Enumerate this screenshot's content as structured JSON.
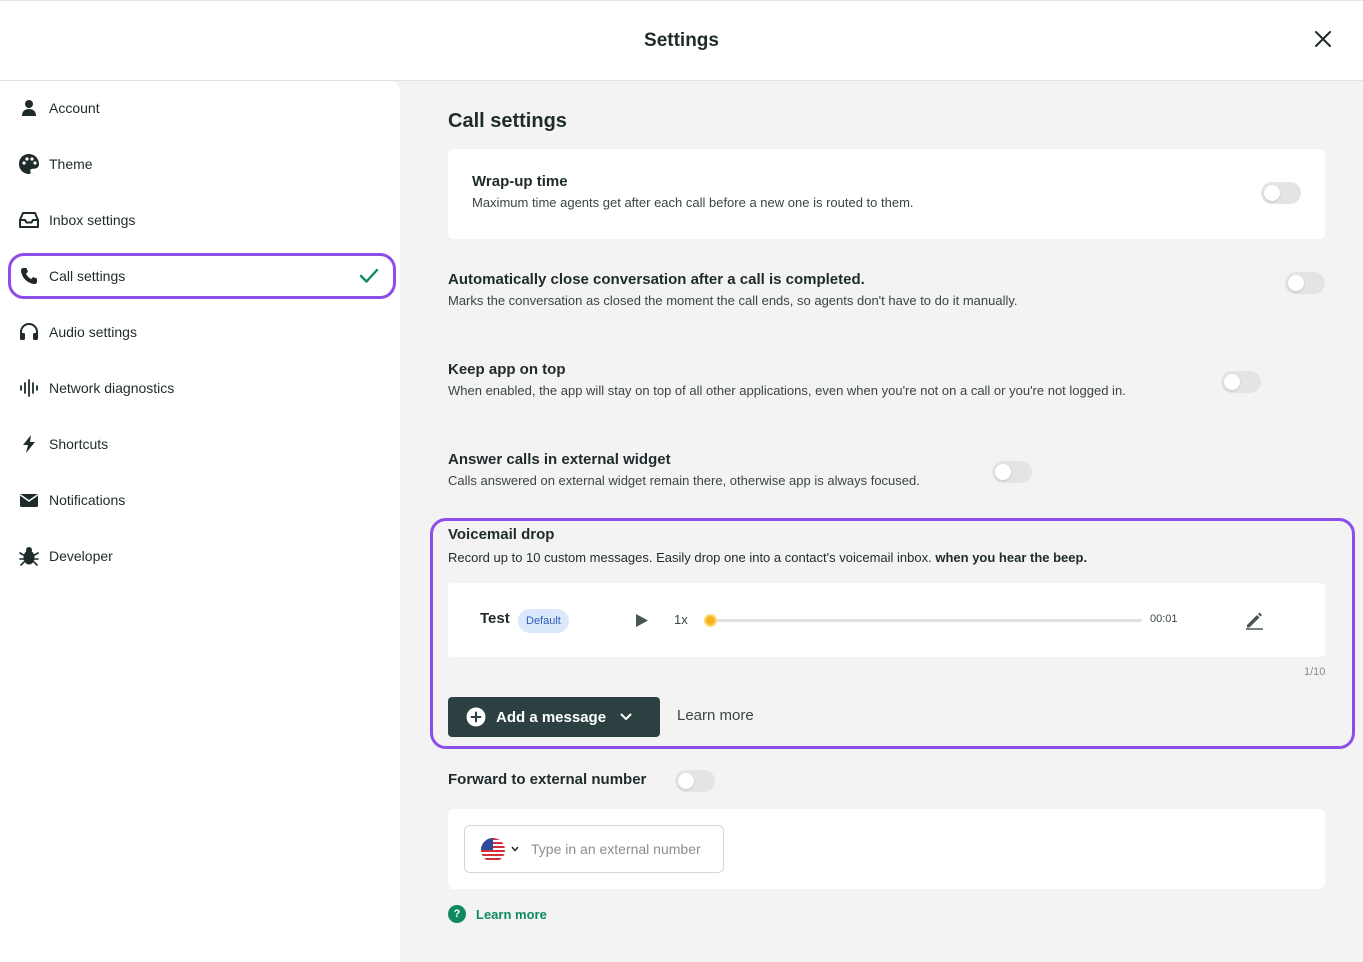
{
  "header": {
    "title": "Settings",
    "close_icon": "close-icon"
  },
  "sidebar": {
    "items": [
      {
        "label": "Account",
        "icon": "person-icon"
      },
      {
        "label": "Theme",
        "icon": "palette-icon"
      },
      {
        "label": "Inbox settings",
        "icon": "inbox-icon"
      },
      {
        "label": "Call settings",
        "icon": "phone-icon",
        "active": true
      },
      {
        "label": "Audio settings",
        "icon": "headset-icon"
      },
      {
        "label": "Network diagnostics",
        "icon": "waveform-icon"
      },
      {
        "label": "Shortcuts",
        "icon": "lightning-icon"
      },
      {
        "label": "Notifications",
        "icon": "envelope-icon"
      },
      {
        "label": "Developer",
        "icon": "bug-icon"
      }
    ]
  },
  "main": {
    "title": "Call settings",
    "settings": [
      {
        "title": "Wrap-up time",
        "desc": "Maximum time agents get after each call before a new one is routed to them.",
        "enabled": false
      },
      {
        "title": "Automatically close conversation after a call is completed.",
        "desc": "Marks the conversation as closed the moment the call ends, so agents don't have to do it manually.",
        "enabled": false
      },
      {
        "title": "Keep app on top",
        "desc": "When enabled, the app will stay on top of all other applications, even when you're not on a call or you're not logged in.",
        "enabled": false
      },
      {
        "title": "Answer calls in external widget",
        "desc": "Calls answered on external widget remain there, otherwise app is always focused.",
        "enabled": false
      }
    ],
    "voicemail": {
      "title": "Voicemail drop",
      "desc": "Record up to 10 custom messages. Easily drop one into a contact's voicemail inbox.",
      "desc_bold": "when you hear the beep.",
      "message": {
        "name": "Test",
        "badge": "Default",
        "speed": "1x",
        "time": "00:01",
        "progress": 0
      },
      "counter": "1/10",
      "add_button": "Add a message",
      "learn_more": "Learn more"
    },
    "forward": {
      "label": "Forward to external number",
      "enabled": false,
      "placeholder": "Type in an external number",
      "learn_more": "Learn more",
      "help_icon": "?"
    }
  },
  "colors": {
    "accent": "#8d4dea",
    "primary_button": "#2d4041",
    "link_green": "#0f8a5f",
    "knob": "#f6b31c"
  }
}
